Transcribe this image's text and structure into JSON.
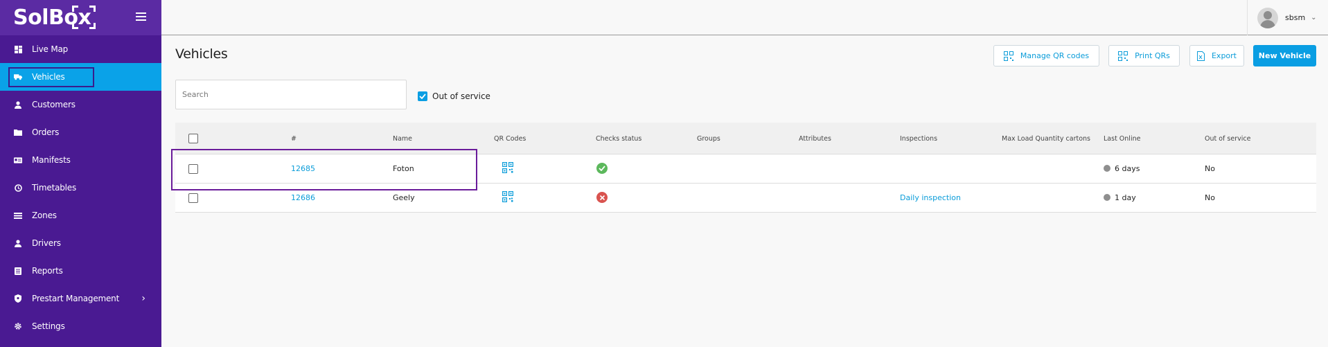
{
  "sidebar": {
    "logo_text": "SolBox",
    "items": [
      {
        "label": "Live Map",
        "icon": "dashboard-icon"
      },
      {
        "label": "Vehicles",
        "icon": "truck-icon",
        "active": true
      },
      {
        "label": "Customers",
        "icon": "person-icon"
      },
      {
        "label": "Orders",
        "icon": "folder-icon"
      },
      {
        "label": "Manifests",
        "icon": "card-icon"
      },
      {
        "label": "Timetables",
        "icon": "clock-icon"
      },
      {
        "label": "Zones",
        "icon": "zones-icon"
      },
      {
        "label": "Drivers",
        "icon": "person-icon"
      },
      {
        "label": "Reports",
        "icon": "report-icon"
      },
      {
        "label": "Prestart Management",
        "icon": "shield-icon",
        "has_submenu": true
      },
      {
        "label": "Settings",
        "icon": "gear-icon"
      }
    ]
  },
  "topbar": {
    "username": "sbsm"
  },
  "page": {
    "title": "Vehicles",
    "buttons": {
      "manage_qr": "Manage QR codes",
      "print_qrs": "Print QRs",
      "export": "Export",
      "new_vehicle": "New Vehicle"
    },
    "search_placeholder": "Search",
    "out_of_service_filter": "Out of service"
  },
  "table": {
    "headers": [
      "#",
      "Name",
      "QR Codes",
      "Checks status",
      "Groups",
      "Attributes",
      "Inspections",
      "Max Load Quantity cartons",
      "Last Online",
      "Out of service"
    ],
    "rows": [
      {
        "id": "12685",
        "name": "Foton",
        "checks": "pass",
        "groups": "",
        "attributes": "",
        "inspections": "",
        "max_load": "",
        "last_online": "6 days",
        "out_of_service": "No"
      },
      {
        "id": "12686",
        "name": "Geely",
        "checks": "fail",
        "groups": "",
        "attributes": "",
        "inspections": "Daily inspection",
        "max_load": "",
        "last_online": "1 day",
        "out_of_service": "No"
      }
    ]
  },
  "colors": {
    "sidebar_bg": "#4a1a92",
    "active": "#0aa2e8",
    "accent": "#0a9ee3",
    "pass": "#5cb85c",
    "fail": "#d9534f"
  }
}
